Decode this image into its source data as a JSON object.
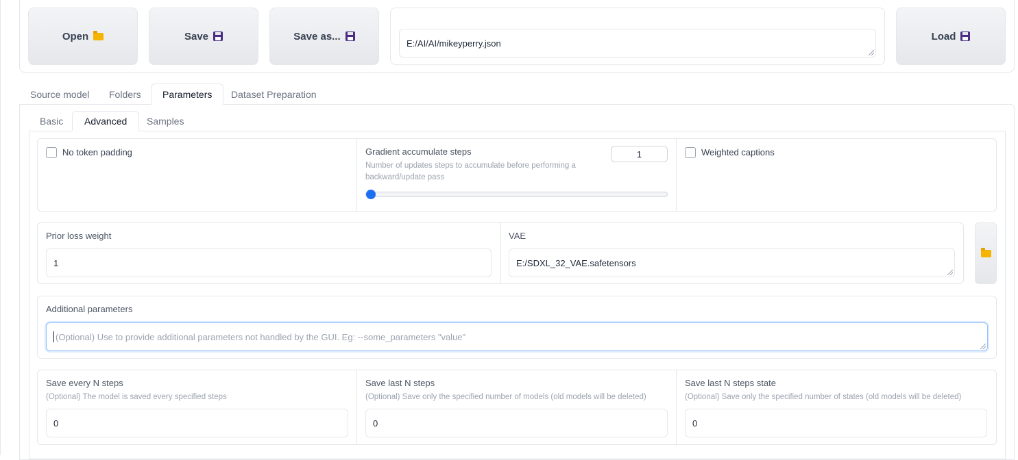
{
  "toolbar": {
    "open_label": "Open",
    "save_label": "Save",
    "save_as_label": "Save as...",
    "load_label": "Load",
    "config_path_value": "E:/AI/AI/mikeyperry.json"
  },
  "main_tabs": [
    "Source model",
    "Folders",
    "Parameters",
    "Dataset Preparation"
  ],
  "main_tab_active": "Parameters",
  "sub_tabs": [
    "Basic",
    "Advanced",
    "Samples"
  ],
  "sub_tab_active": "Advanced",
  "advanced": {
    "no_token_padding_label": "No token padding",
    "no_token_padding_checked": false,
    "gradient_label": "Gradient accumulate steps",
    "gradient_info": "Number of updates steps to accumulate before performing a backward/update pass",
    "gradient_value": "1",
    "gradient_slider_fraction": 0,
    "weighted_captions_label": "Weighted captions",
    "weighted_captions_checked": false,
    "prior_loss_label": "Prior loss weight",
    "prior_loss_value": "1",
    "vae_label": "VAE",
    "vae_value": "E:/SDXL_32_VAE.safetensors",
    "additional_label": "Additional parameters",
    "additional_placeholder": "(Optional) Use to provide additional parameters not handled by the GUI. Eg: --some_parameters \"value\"",
    "save_every_label": "Save every N steps",
    "save_every_info": "(Optional) The model is saved every specified steps",
    "save_every_value": "0",
    "save_last_label": "Save last N steps",
    "save_last_info": "(Optional) Save only the specified number of models (old models will be deleted)",
    "save_last_value": "0",
    "save_last_state_label": "Save last N steps state",
    "save_last_state_info": "(Optional) Save only the specified number of states (old models will be deleted)",
    "save_last_state_value": "0"
  },
  "colors": {
    "accent": "#1d6ff2",
    "folder_icon": "#f5b400",
    "floppy_icon": "#4b2e83"
  },
  "icons": {
    "open": "folder-icon",
    "save": "floppy-disk-icon",
    "save_as": "floppy-disk-icon",
    "load": "floppy-disk-icon",
    "vae_browse": "folder-icon"
  }
}
